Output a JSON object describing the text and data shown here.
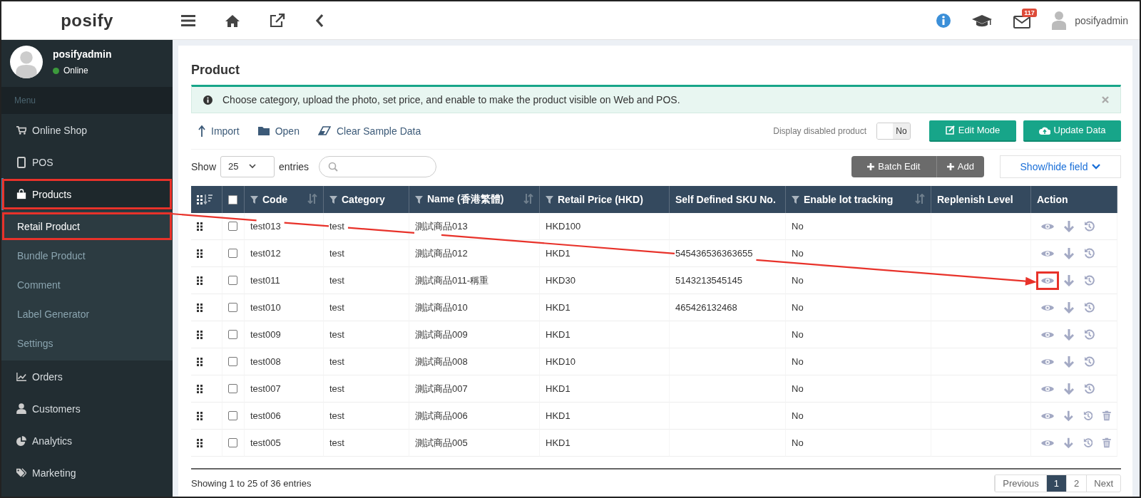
{
  "header": {
    "logo": "posify",
    "mail_count": "117",
    "user": "posifyadmin"
  },
  "sidebar": {
    "user": "posifyadmin",
    "status": "Online",
    "menu_label": "Menu",
    "items": [
      {
        "kind": "cart",
        "label": "Online Shop",
        "expanded": false,
        "annotated": false
      },
      {
        "kind": "tablet",
        "label": "POS",
        "expanded": false,
        "annotated": false
      },
      {
        "kind": "bag",
        "label": "Products",
        "expanded": true,
        "annotated": true,
        "children": [
          {
            "label": "Retail Product",
            "selected": true,
            "annotated": true
          },
          {
            "label": "Bundle Product",
            "selected": false,
            "annotated": false
          },
          {
            "label": "Comment",
            "selected": false,
            "annotated": false
          },
          {
            "label": "Label Generator",
            "selected": false,
            "annotated": false
          },
          {
            "label": "Settings",
            "selected": false,
            "annotated": false
          }
        ]
      },
      {
        "kind": "chart",
        "label": "Orders",
        "expanded": false,
        "annotated": false
      },
      {
        "kind": "user",
        "label": "Customers",
        "expanded": false,
        "annotated": false
      },
      {
        "kind": "pie",
        "label": "Analytics",
        "expanded": false,
        "annotated": false
      },
      {
        "kind": "tag",
        "label": "Marketing",
        "expanded": false,
        "annotated": false
      }
    ]
  },
  "page": {
    "title": "Product",
    "notice": "Choose category, upload the photo, set price, and enable to make the product visible on Web and POS.",
    "toolbar": [
      {
        "kind": "import",
        "label": "Import"
      },
      {
        "kind": "open",
        "label": "Open"
      },
      {
        "kind": "eraser",
        "label": "Clear Sample Data"
      }
    ],
    "display_disabled": {
      "label": "Display disabled product",
      "value": "No",
      "on": false
    },
    "buttons": [
      {
        "kind": "edit",
        "label": "Edit Mode"
      },
      {
        "kind": "cloud",
        "label": "Update Data"
      }
    ],
    "show_label": "Show",
    "page_size": "25",
    "entries_label": "entries",
    "batch_buttons": [
      {
        "label": "Batch Edit"
      },
      {
        "label": "Add"
      }
    ],
    "show_hide": "Show/hide field"
  },
  "table": {
    "select_all_checked": false,
    "columns": [
      {
        "label": "Code",
        "filter": true,
        "sortable": true
      },
      {
        "label": "Category",
        "filter": true,
        "sortable": false
      },
      {
        "label": "Name (香港繁體)",
        "filter": true,
        "sortable": true
      },
      {
        "label": "Retail Price (HKD)",
        "filter": true,
        "sortable": false
      },
      {
        "label": "Self Defined SKU No.",
        "filter": false,
        "sortable": false
      },
      {
        "label": "Enable lot tracking",
        "filter": true,
        "sortable": true
      },
      {
        "label": "Replenish Level",
        "filter": false,
        "sortable": false
      },
      {
        "label": "Action",
        "filter": false,
        "sortable": false
      }
    ],
    "rows": [
      {
        "code": "test013",
        "category": "test",
        "name": "測試商品013",
        "price": "HKD100",
        "sku": "",
        "lot_tracking": "No",
        "checked": false,
        "deletable": false,
        "annotated": false
      },
      {
        "code": "test012",
        "category": "test",
        "name": "測試商品012",
        "price": "HKD1",
        "sku": "545436536363655",
        "lot_tracking": "No",
        "checked": false,
        "deletable": false,
        "annotated": false
      },
      {
        "code": "test011",
        "category": "test",
        "name": "測試商品011-稱重",
        "price": "HKD30",
        "sku": "5143213545145",
        "lot_tracking": "No",
        "checked": false,
        "deletable": false,
        "annotated": true
      },
      {
        "code": "test010",
        "category": "test",
        "name": "測試商品010",
        "price": "HKD1",
        "sku": "465426132468",
        "lot_tracking": "No",
        "checked": false,
        "deletable": false,
        "annotated": false
      },
      {
        "code": "test009",
        "category": "test",
        "name": "測試商品009",
        "price": "HKD1",
        "sku": "",
        "lot_tracking": "No",
        "checked": false,
        "deletable": false,
        "annotated": false
      },
      {
        "code": "test008",
        "category": "test",
        "name": "測試商品008",
        "price": "HKD10",
        "sku": "",
        "lot_tracking": "No",
        "checked": false,
        "deletable": false,
        "annotated": false
      },
      {
        "code": "test007",
        "category": "test",
        "name": "測試商品007",
        "price": "HKD1",
        "sku": "",
        "lot_tracking": "No",
        "checked": false,
        "deletable": false,
        "annotated": false
      },
      {
        "code": "test006",
        "category": "test",
        "name": "測試商品006",
        "price": "HKD1",
        "sku": "",
        "lot_tracking": "No",
        "checked": false,
        "deletable": true,
        "annotated": false
      },
      {
        "code": "test005",
        "category": "test",
        "name": "測試商品005",
        "price": "HKD1",
        "sku": "",
        "lot_tracking": "No",
        "checked": false,
        "deletable": true,
        "annotated": false
      }
    ],
    "summary": "Showing 1 to 25 of 36 entries",
    "pagination": [
      {
        "label": "Previous",
        "selected": false
      },
      {
        "label": "1",
        "selected": true
      },
      {
        "label": "2",
        "selected": false
      },
      {
        "label": "Next",
        "selected": false
      }
    ]
  }
}
